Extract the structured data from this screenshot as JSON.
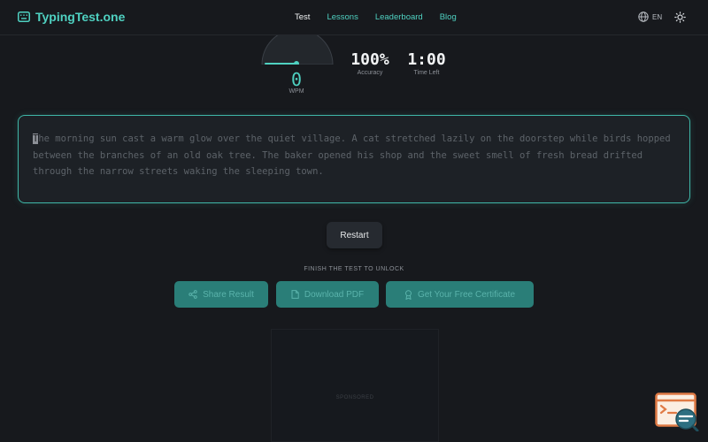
{
  "header": {
    "logo_text": "TypingTest.one",
    "nav": [
      {
        "label": "Test",
        "active": true
      },
      {
        "label": "Lessons",
        "active": false
      },
      {
        "label": "Leaderboard",
        "active": false
      },
      {
        "label": "Blog",
        "active": false
      }
    ],
    "language": "EN"
  },
  "stats": {
    "wpm_value": "0",
    "wpm_label": "WPM",
    "accuracy_value": "100%",
    "accuracy_label": "Accuracy",
    "time_value": "1:00",
    "time_label": "Time Left"
  },
  "typing": {
    "first_char": "T",
    "rest_text": "he morning sun cast a warm glow over the quiet village. A cat stretched lazily on the doorstep while birds hopped between the branches of an old oak tree. The baker opened his shop and the sweet smell of fresh bread drifted through the narrow streets waking the sleeping town."
  },
  "controls": {
    "restart_label": "Restart",
    "unlock_label": "FINISH THE TEST TO UNLOCK",
    "share_label": "Share Result",
    "download_label": "Download PDF",
    "certificate_label": "Get Your Free Certificate"
  },
  "ad": {
    "label": "SPONSORED"
  },
  "colors": {
    "accent": "#4fd1c1",
    "background": "#17191d",
    "locked_button": "#2a7e78",
    "widget_orange": "#e07a45"
  },
  "icons": {
    "logo": "keyboard-icon",
    "language": "globe-icon",
    "theme": "sun-icon",
    "share": "share-icon",
    "download": "file-icon",
    "certificate": "award-icon",
    "widget": "chat-widget-icon"
  }
}
